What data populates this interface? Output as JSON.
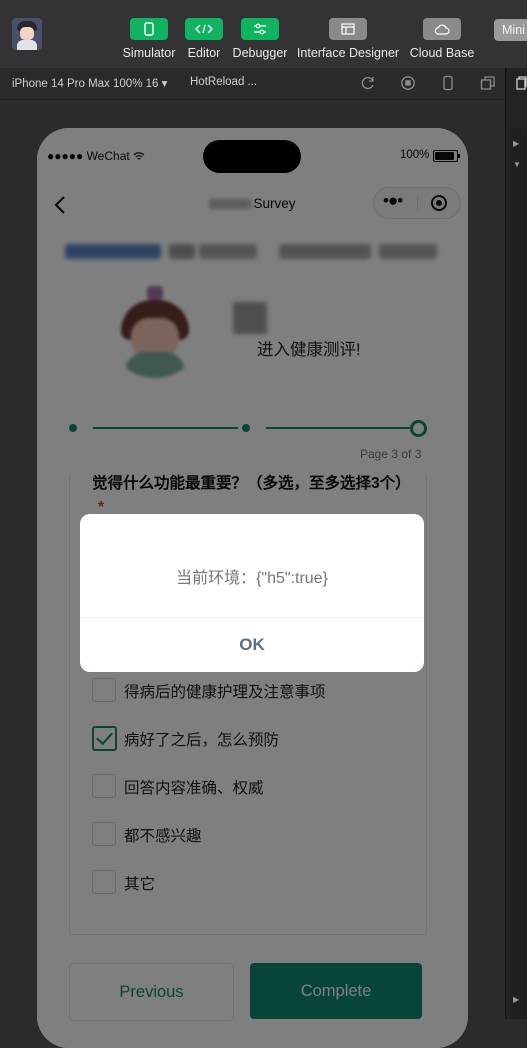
{
  "toolbar": {
    "buttons": [
      {
        "label": "Simulator",
        "icon": "phone-icon"
      },
      {
        "label": "Editor",
        "icon": "code-icon"
      },
      {
        "label": "Debugger",
        "icon": "sliders-icon"
      },
      {
        "label": "Interface Designer",
        "icon": "layout-icon"
      },
      {
        "label": "Cloud Base",
        "icon": "cloud-icon"
      }
    ],
    "mini_label": "Mini"
  },
  "subbar": {
    "device": "iPhone 14 Pro Max 100% 16 ▾",
    "hotreload": "HotReload ..."
  },
  "phone": {
    "status": {
      "carrier": "●●●●● WeChat",
      "battery": "100%"
    },
    "nav_title": "Survey",
    "hero_text": "进入健康测评!",
    "progress": {
      "current_step": 3,
      "total_steps": 3,
      "page_label": "Page 3 of 3"
    },
    "question": {
      "title": "觉得什么功能最重要？（多选，至多选择3个）",
      "required_mark": "*",
      "options": [
        {
          "label": "得病后的健康护理及注意事项",
          "checked": false
        },
        {
          "label": "病好了之后，怎么预防",
          "checked": true
        },
        {
          "label": "回答内容准确、权威",
          "checked": false
        },
        {
          "label": "都不感兴趣",
          "checked": false
        },
        {
          "label": "其它",
          "checked": false
        }
      ]
    },
    "buttons": {
      "previous": "Previous",
      "complete": "Complete"
    },
    "dialog": {
      "message": "当前环境：{\"h5\":true}",
      "ok": "OK"
    }
  },
  "colors": {
    "accent": "#0e8a73",
    "toolbar_green": "#10b35f",
    "dialog_link": "#576b95",
    "required": "#e23b3b"
  }
}
